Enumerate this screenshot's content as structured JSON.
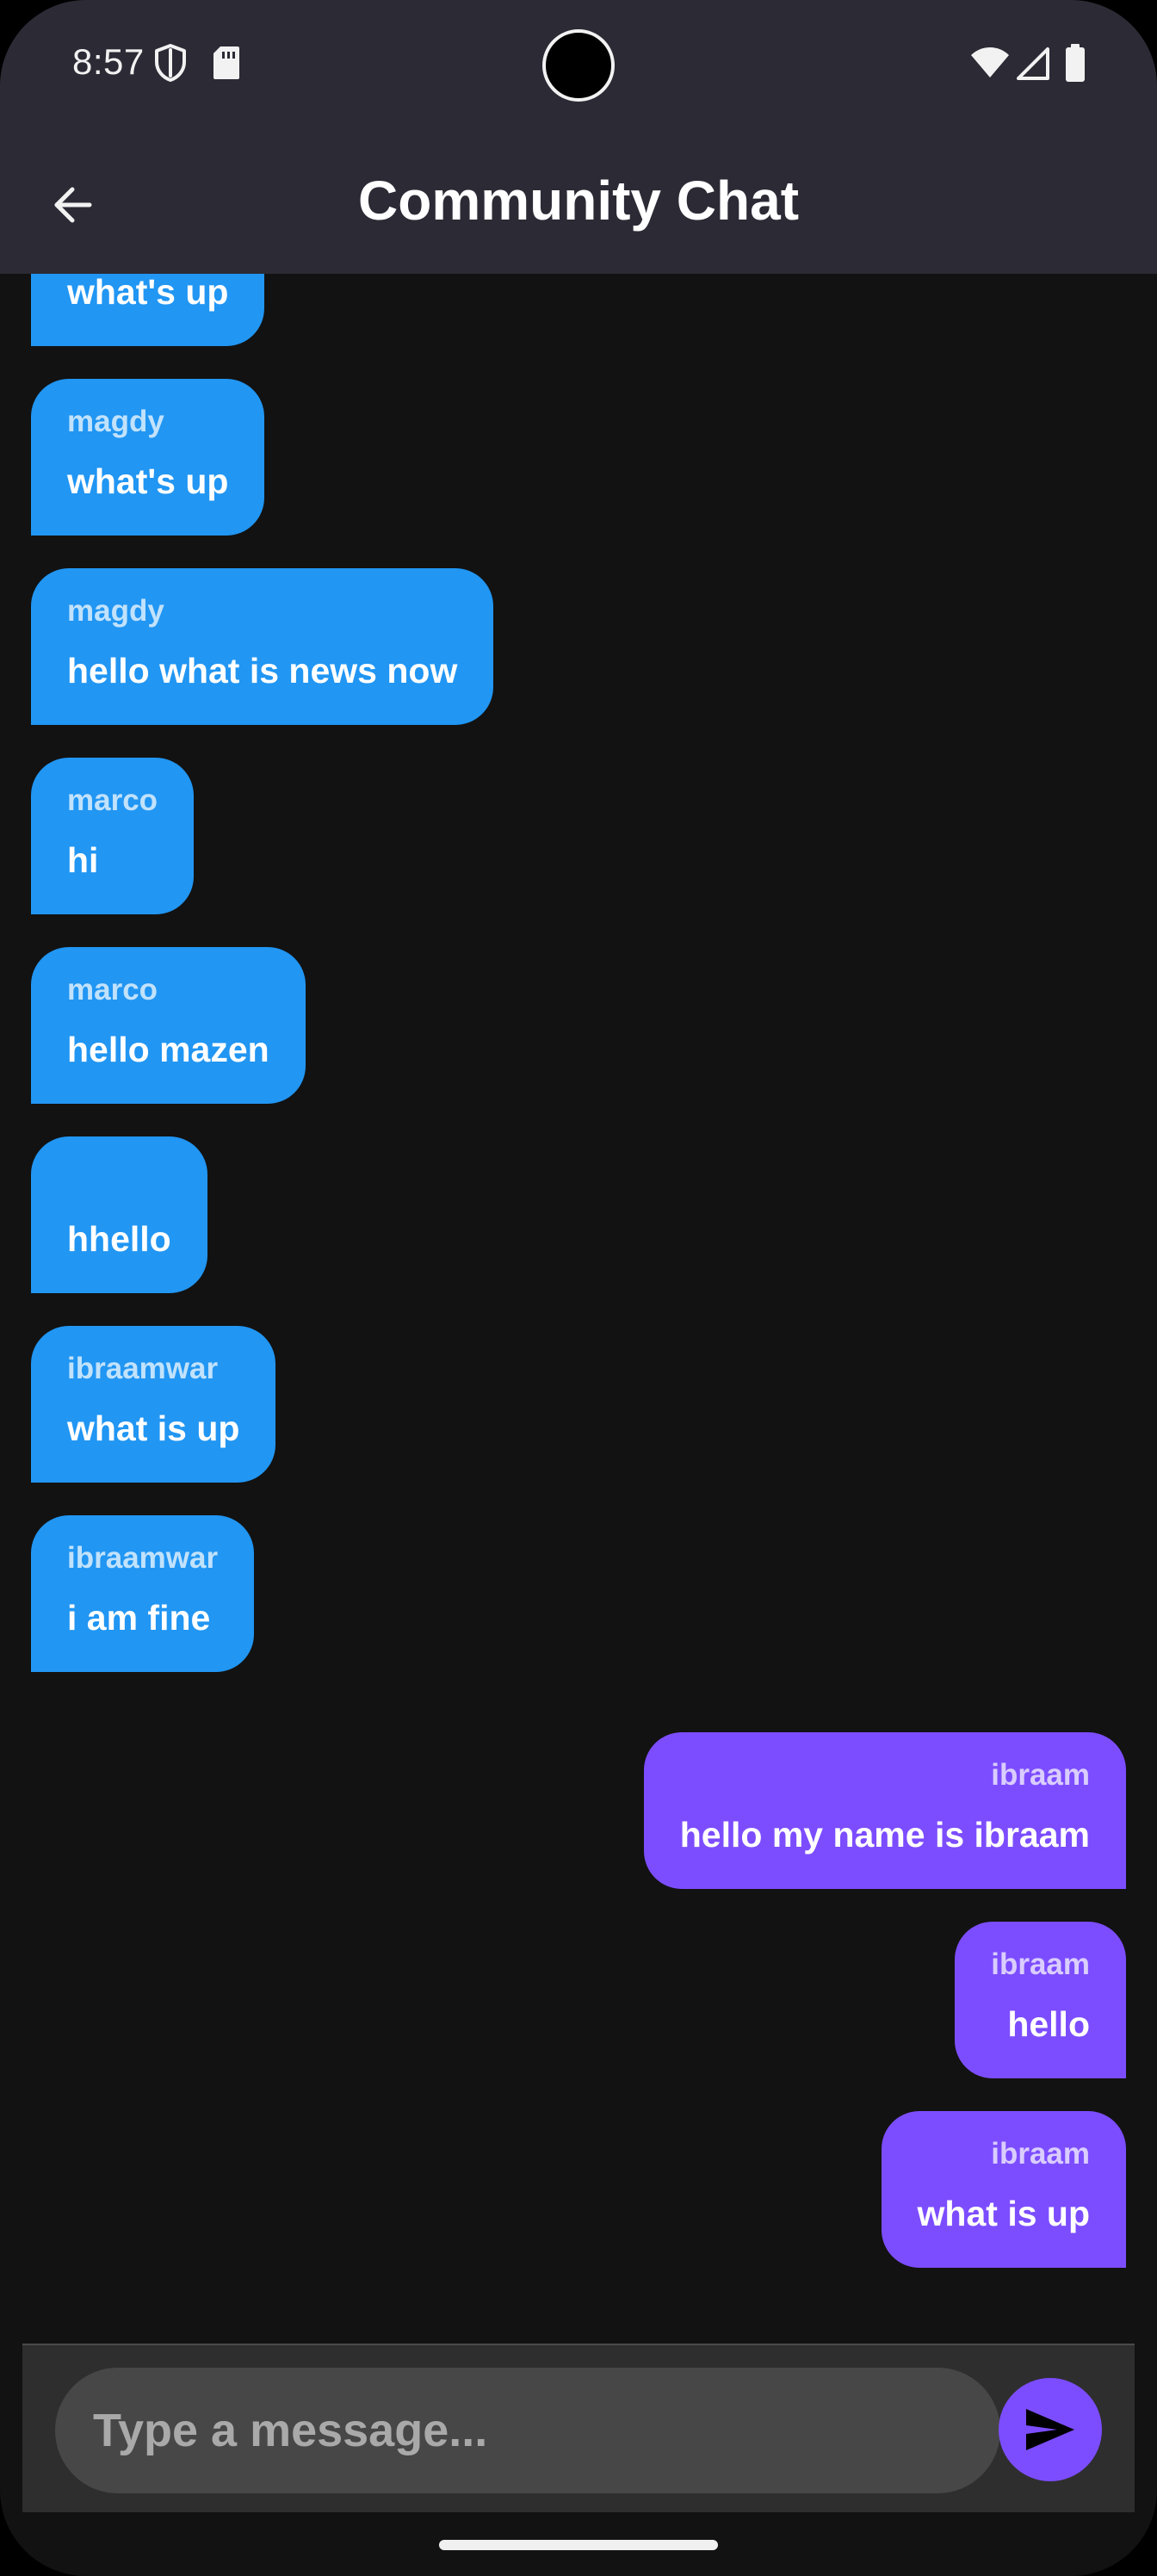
{
  "status_bar": {
    "time": "8:57",
    "left_icons": [
      "shield-icon",
      "sd-card-icon"
    ],
    "right_icons": [
      "wifi-icon",
      "cell-signal-icon",
      "battery-icon"
    ]
  },
  "app_bar": {
    "title": "Community Chat",
    "back_icon": "arrow-back-icon"
  },
  "messages": [
    {
      "sender": "magdy",
      "text": "what's up",
      "outgoing": false
    },
    {
      "sender": "magdy",
      "text": "what's up",
      "outgoing": false
    },
    {
      "sender": "magdy",
      "text": "hello what is news now",
      "outgoing": false
    },
    {
      "sender": "marco",
      "text": "hi",
      "outgoing": false
    },
    {
      "sender": "marco",
      "text": "hello mazen",
      "outgoing": false
    },
    {
      "sender": "",
      "text": "hhello",
      "outgoing": false
    },
    {
      "sender": "ibraamwar",
      "text": "what is up",
      "outgoing": false
    },
    {
      "sender": "ibraamwar",
      "text": "i am fine",
      "outgoing": false
    },
    {
      "sender": "ibraam",
      "text": "hello my name is ibraam",
      "outgoing": true
    },
    {
      "sender": "ibraam",
      "text": "hello",
      "outgoing": true
    },
    {
      "sender": "ibraam",
      "text": "what is up",
      "outgoing": true
    }
  ],
  "composer": {
    "placeholder": "Type a message...",
    "value": "",
    "send_icon": "send-icon"
  },
  "colors": {
    "incoming_bubble": "#2196f3",
    "outgoing_bubble": "#7c4dff",
    "background": "#121212",
    "app_bar": "#2c2a35"
  }
}
